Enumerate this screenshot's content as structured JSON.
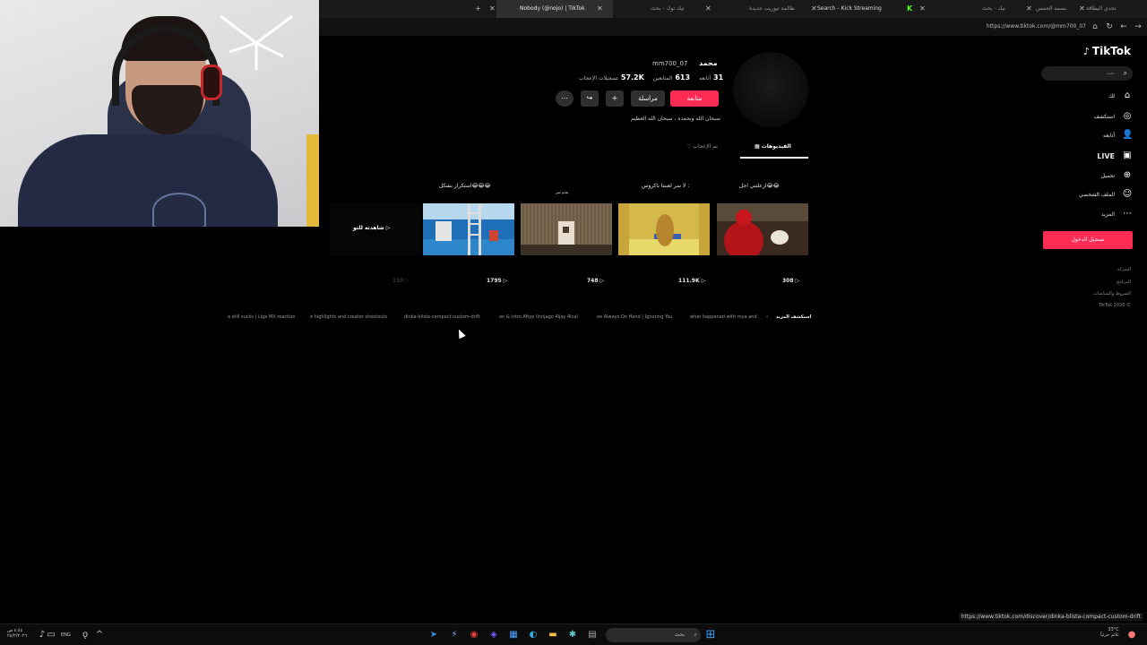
{
  "browser": {
    "tabs": [
      {
        "title": "Nobody (@nojo) | TikTok",
        "active": true
      },
      {
        "title": "تيك توك - بحث",
        "active": false
      },
      {
        "title": "ظالمة تيوريب جديدة",
        "active": false
      },
      {
        "title": "Search - Kick Streaming",
        "active": false
      },
      {
        "title": "تيك - بحث",
        "active": false
      },
      {
        "title": "بسمه الحمس",
        "active": false
      },
      {
        "title": "تحدي البطاقة",
        "active": false
      }
    ],
    "url": "https://www.tiktok.com/@mm700_07"
  },
  "sidebar": {
    "logo": "TikTok",
    "search_placeholder": "بحث",
    "items": [
      {
        "label": "لك",
        "icon": "home-icon"
      },
      {
        "label": "استكشف",
        "icon": "compass-icon"
      },
      {
        "label": "أتابعه",
        "icon": "user-plus-icon"
      },
      {
        "label": "LIVE",
        "icon": "live-icon"
      },
      {
        "label": "تحميل",
        "icon": "upload-icon"
      },
      {
        "label": "الملف الشخصي",
        "icon": "profile-icon"
      },
      {
        "label": "المزيد",
        "icon": "more-icon"
      }
    ],
    "login_label": "تسجيل الدخول",
    "footer": [
      "الشركة",
      "البرنامج",
      "الشروط والسياسات",
      "TikTok 2026 ©"
    ]
  },
  "profile": {
    "display_name": "محمد",
    "username": "mm700_07",
    "stats": {
      "following_count": "31",
      "following_label": "أتابعه",
      "followers_count": "613",
      "followers_label": "المتابعين",
      "likes_count": "57.2K",
      "likes_label": "تسجيلات الإعجاب"
    },
    "follow_label": "متابعة",
    "message_label": "مراسلة",
    "bio": "سبحان الله وبحمده ، سبحان الله العظيم"
  },
  "tabs": {
    "videos": "الفيديوهات",
    "liked": "تم الإعجاب"
  },
  "videos": [
    {
      "caption": "ازعلتني اجل😂😂",
      "views": "308"
    },
    {
      "caption": "لا سر لعبتنا باكروس :",
      "views": "111.9K"
    },
    {
      "caption": "يقدم سر",
      "views": "748"
    },
    {
      "caption": "استكراز بشكل😂😂😂",
      "views": "1795"
    },
    {
      "caption": "",
      "views": "158"
    }
  ],
  "watch_label": "شاهدته للتو",
  "discover": {
    "title": "استكشف المزيد",
    "items": [
      "what happened with mya and",
      "ee Always On Hand | Ignoring You",
      "on & intro Aftyp ilnnjago 4ljay 4lcal",
      "dinka-blista-compact-custom-drift",
      "e highlights and creator shootouts",
      "a still sucks | Liga MX reaction"
    ]
  },
  "status_url": "https://www.tiktok.com/discover/dinka-blista-compact-custom-drift",
  "taskbar": {
    "search_label": "بحث",
    "lang": "ENG",
    "time": "٤:٤٤ ص",
    "date": "٢٨/٢/٢٠٢٦",
    "weather_temp": "33°C",
    "weather_label": "غائم جزئياً"
  }
}
